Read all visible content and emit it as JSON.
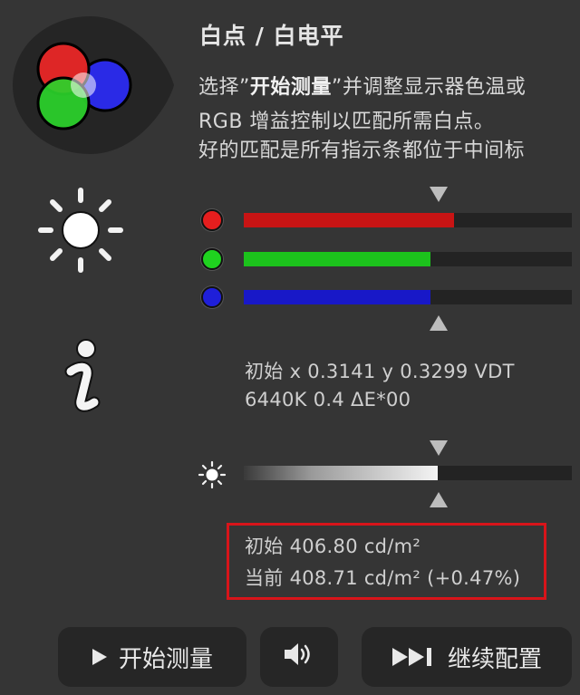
{
  "header": {
    "title": "白点 / 白电平"
  },
  "description": {
    "line1_a": "选择”",
    "line1_bold": "开始测量",
    "line1_b": "”并调整显示器色温或",
    "line2": "RGB 增益控制以匹配所需白点。",
    "line3": "好的匹配是所有指示条都位于中间标"
  },
  "channels": [
    {
      "name": "red",
      "color": "#e51e1e",
      "bar_color": "#c81414",
      "level": 0.64
    },
    {
      "name": "green",
      "color": "#1fd21f",
      "bar_color": "#1cc21c",
      "level": 0.57
    },
    {
      "name": "blue",
      "color": "#1f1fd9",
      "bar_color": "#1818c8",
      "level": 0.57
    }
  ],
  "readout": {
    "line1": "初始 x 0.3141 y 0.3299 VDT",
    "line2": "6440K 0.4 ΔE*00"
  },
  "luminance": {
    "level": 0.59,
    "initial": "初始 406.80 cd/m²",
    "current": "当前 408.71 cd/m² (+0.47%)",
    "highlight_color": "#d8141a"
  },
  "buttons": {
    "start": "开始测量",
    "next": "继续配置"
  },
  "icons": {
    "rgb_badge": "rgb-circles-icon",
    "brightness": "sun-icon",
    "info": "info-icon",
    "play": "play-icon",
    "sound": "speaker-icon",
    "skip": "skip-forward-icon"
  }
}
